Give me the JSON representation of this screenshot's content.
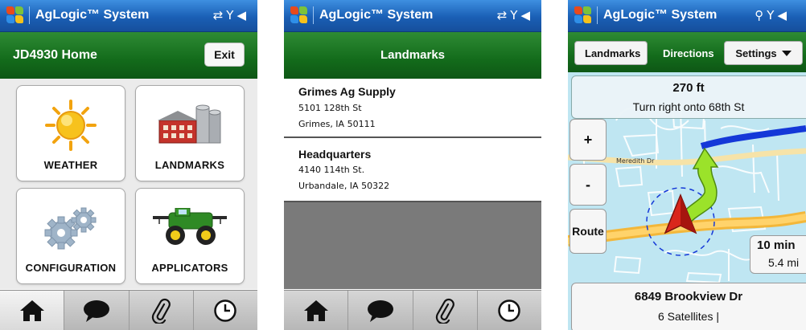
{
  "status_bar": {
    "app_title": "AgLogic™ System",
    "icons": [
      "sync-icon",
      "signal-off-icon",
      "volume-icon"
    ]
  },
  "home": {
    "title": "JD4930 Home",
    "exit_label": "Exit",
    "tiles": [
      {
        "label": "WEATHER",
        "icon": "sun-icon"
      },
      {
        "label": "LANDMARKS",
        "icon": "buildings-icon"
      },
      {
        "label": "CONFIGURATION",
        "icon": "gears-icon"
      },
      {
        "label": "APPLICATORS",
        "icon": "sprayer-icon"
      }
    ]
  },
  "tab_bar": {
    "tabs": [
      "home-icon",
      "chat-icon",
      "paperclip-icon",
      "clock-icon"
    ]
  },
  "landmarks": {
    "title": "Landmarks",
    "items": [
      {
        "name": "Grimes Ag Supply",
        "street": "5101 128th St",
        "city": "Grimes, IA 50111"
      },
      {
        "name": "Headquarters",
        "street": "4140 114th  St.",
        "city": "Urbandale, IA 50322"
      }
    ]
  },
  "navigation": {
    "back_label": "Landmarks",
    "directions_label": "Directions",
    "settings_label": "Settings",
    "distance": "270 ft",
    "instruction": "Turn right onto 68th St",
    "street_label": "Meredith Dr",
    "zoom_in": "+",
    "zoom_out": "-",
    "route_label": "Route",
    "eta_minutes": "10 min",
    "eta_distance": "5.4 mi",
    "destination": "6849 Brookview Dr",
    "satellites": "6 Satellites |"
  },
  "colors": {
    "status_blue": "#1a5fb5",
    "header_green": "#136b1b",
    "route_blue": "#1438d8",
    "turn_arrow": "#9be22a",
    "position_marker": "#d9261c"
  }
}
